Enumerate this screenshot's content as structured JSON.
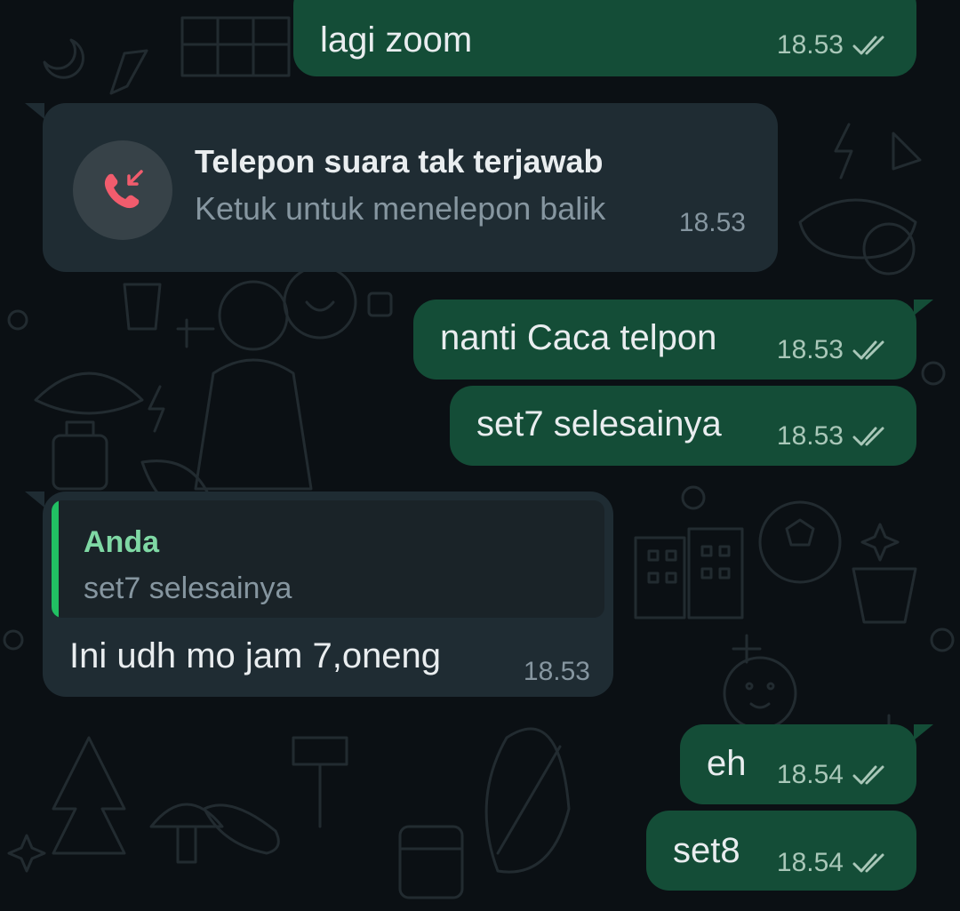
{
  "theme": {
    "outgoing_bubble": "#144d37",
    "incoming_bubble": "#1f2c33",
    "background": "#0b1014",
    "missed_call_icon_color": "#f15c6d",
    "reply_accent": "#21c063"
  },
  "messages": [
    {
      "type": "outgoing",
      "text": "lagi zoom",
      "time": "18.53",
      "status_icon": "double-check-icon"
    },
    {
      "type": "missed-call",
      "title": "Telepon suara tak terjawab",
      "subtitle": "Ketuk untuk menelepon balik",
      "time": "18.53",
      "icon": "missed-call-icon"
    },
    {
      "type": "outgoing",
      "text": "nanti Caca telpon",
      "time": "18.53",
      "status_icon": "double-check-icon"
    },
    {
      "type": "outgoing",
      "text": "set7 selesainya",
      "time": "18.53",
      "status_icon": "double-check-icon"
    },
    {
      "type": "incoming-reply",
      "quoted_author": "Anda",
      "quoted_text": "set7 selesainya",
      "text": "Ini udh mo jam 7,oneng",
      "time": "18.53"
    },
    {
      "type": "outgoing",
      "text": "eh",
      "time": "18.54",
      "status_icon": "double-check-icon"
    },
    {
      "type": "outgoing",
      "text": "set8",
      "time": "18.54",
      "status_icon": "double-check-icon"
    }
  ]
}
